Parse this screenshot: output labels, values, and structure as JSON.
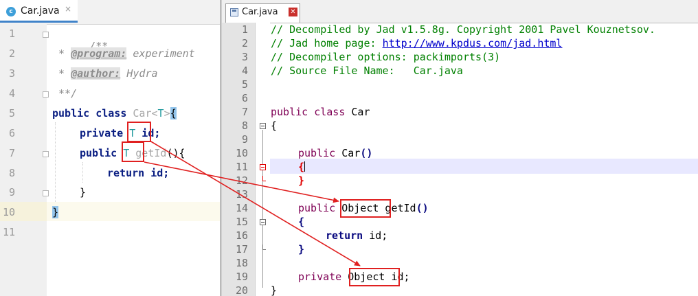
{
  "left_editor": {
    "tab": {
      "icon": "class-c-icon",
      "label": "Car.java",
      "close": "×"
    },
    "line_numbers": [
      "1",
      "2",
      "3",
      "4",
      "5",
      "6",
      "7",
      "8",
      "9",
      "10",
      "11"
    ],
    "current_line": "10",
    "code": {
      "l1": "/**",
      "l2_star": " * ",
      "l2_tag": "@program:",
      "l2_val": " experiment",
      "l3_star": " * ",
      "l3_tag": "@author:",
      "l3_val": " Hydra",
      "l4": " **/",
      "l5_kw": "public class ",
      "l5_name": "Car<",
      "l5_tp": "T",
      "l5_close": ">",
      "l5_brace": "{",
      "l6_kw": "private ",
      "l6_tp": "T",
      "l6_rest": " id;",
      "l7_kw": "public ",
      "l7_tp": "T",
      "l7_method": " getId",
      "l7_rest": "(){",
      "l8_kw": "return ",
      "l8_rest": "id;",
      "l9": "}",
      "l10": "}"
    }
  },
  "right_editor": {
    "tab": {
      "icon": "save-icon",
      "label": "Car.java",
      "close": "✕"
    },
    "line_numbers": [
      "1",
      "2",
      "3",
      "4",
      "5",
      "6",
      "7",
      "8",
      "9",
      "10",
      "11",
      "12",
      "13",
      "14",
      "15",
      "16",
      "17",
      "18",
      "19",
      "20"
    ],
    "code": {
      "l1": "// Decompiled by Jad v1.5.8g. Copyright 2001 Pavel Kouznetsov.",
      "l2_pre": "// Jad home page: ",
      "l2_url": "http://www.kpdus.com/jad.html",
      "l3": "// Decompiler options: packimports(3)",
      "l4": "// Source File Name:   Car.java",
      "l7_kw": "public class ",
      "l7_name": "Car",
      "l8": "{",
      "l10_kw": "public ",
      "l10_name": "Car",
      "l10_paren": "()",
      "l11": "{",
      "l12": "}",
      "l14_kw": "public ",
      "l14_type": "Object",
      "l14_name": " getId",
      "l14_paren": "()",
      "l15": "{",
      "l16_kw": "return ",
      "l16_rest": "id;",
      "l17": "}",
      "l19_kw": "private ",
      "l19_type": "Object",
      "l19_rest": " id;",
      "l20": "}"
    }
  },
  "colors": {
    "annotation": "#e02020",
    "java_keyword": "#0a1e82",
    "type_param": "#20999d",
    "jad_comment": "#008000",
    "jad_keyword": "#7f0055"
  }
}
